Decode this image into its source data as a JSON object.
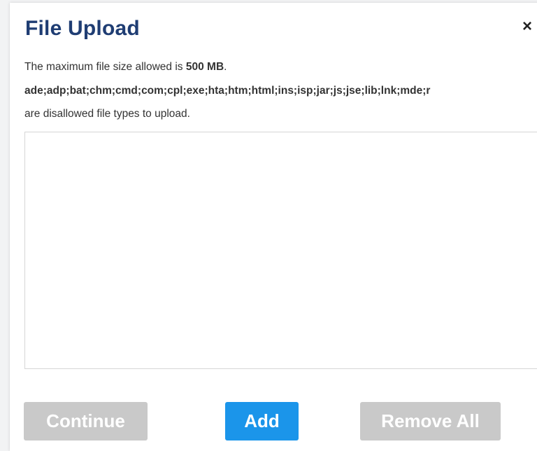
{
  "dialog": {
    "title": "File Upload",
    "close_label": "×"
  },
  "info": {
    "max_size_prefix": "The maximum file size allowed is ",
    "max_size_value": "500 MB",
    "max_size_suffix": ".",
    "disallowed_types": "ade;adp;bat;chm;cmd;com;cpl;exe;hta;htm;html;ins;isp;jar;js;jse;lib;lnk;mde;r",
    "disallowed_note": "are disallowed file types to upload."
  },
  "buttons": {
    "continue_label": "Continue",
    "add_label": "Add",
    "remove_all_label": "Remove All"
  },
  "colors": {
    "title": "#1f3d73",
    "primary_button": "#1b95ea",
    "disabled_button": "#c9c9c9"
  }
}
